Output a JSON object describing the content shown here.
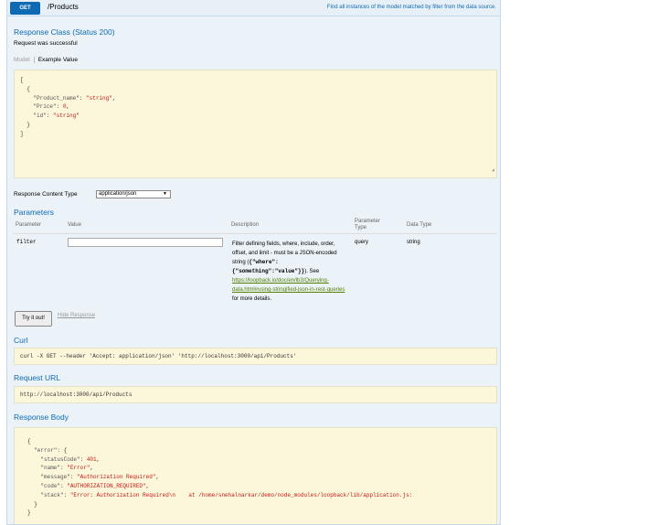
{
  "operation": {
    "method": "GET",
    "path": "/Products",
    "summary": "Find all instances of the model matched by filter from the data source."
  },
  "response_class": {
    "title": "Response Class (Status 200)",
    "message": "Request was successful",
    "tab_model": "Model",
    "tab_example": "Example Value",
    "example_lines": [
      {
        "t": "["
      },
      {
        "t": "  {"
      },
      {
        "k": "    \"Product_name\": ",
        "v": "\"string\"",
        "e": ","
      },
      {
        "k": "    \"Price\": ",
        "v": "0",
        "e": ","
      },
      {
        "k": "    \"id\": ",
        "v": "\"string\"",
        "e": ""
      },
      {
        "t": "  }"
      },
      {
        "t": "]"
      }
    ]
  },
  "response_content_type": {
    "label": "Response Content Type",
    "selected": "application/json"
  },
  "parameters": {
    "title": "Parameters",
    "headers": {
      "parameter": "Parameter",
      "value": "Value",
      "description": "Description",
      "parameter_type_1": "Parameter",
      "parameter_type_2": "Type",
      "data_type": "Data Type"
    },
    "row": {
      "name": "filter",
      "value": "",
      "description_1": "Filter defining fields, where, include, order, offset, and limit - must be a JSON-encoded string (",
      "description_code": "{\"where\":{\"something\":\"value\"}}",
      "description_2": "). See ",
      "description_link": "https://loopback.io/doc/en/lb3/Querying-data.html#using-stringified-json-in-rest-queries",
      "description_3": " for more details.",
      "param_type": "query",
      "data_type": "string"
    }
  },
  "actions": {
    "try_it": "Try it out!",
    "hide_response": "Hide Response"
  },
  "curl": {
    "title": "Curl",
    "command": "curl -X GET --header 'Accept: application/json' 'http://localhost:3000/api/Products'"
  },
  "request_url": {
    "title": "Request URL",
    "url": "http://localhost:3000/api/Products"
  },
  "response_body": {
    "title": "Response Body",
    "lines": [
      {
        "t": "{"
      },
      {
        "k": "  \"error\": ",
        "v": "",
        "e": "{"
      },
      {
        "k": "    \"statusCode\": ",
        "v": "401",
        "e": ","
      },
      {
        "k": "    \"name\": ",
        "v": "\"Error\"",
        "e": ","
      },
      {
        "k": "    \"message\": ",
        "v": "\"Authorization Required\"",
        "e": ","
      },
      {
        "k": "    \"code\": ",
        "v": "\"AUTHORIZATION_REQUIRED\"",
        "e": ","
      },
      {
        "k": "    \"stack\": ",
        "v": "\"Error: Authorization Required\\n    at /home/snehalnarkar/demo/node_modules/loopback/lib/application.js:",
        "e": ""
      },
      {
        "t": "  }"
      },
      {
        "t": "}"
      }
    ]
  }
}
